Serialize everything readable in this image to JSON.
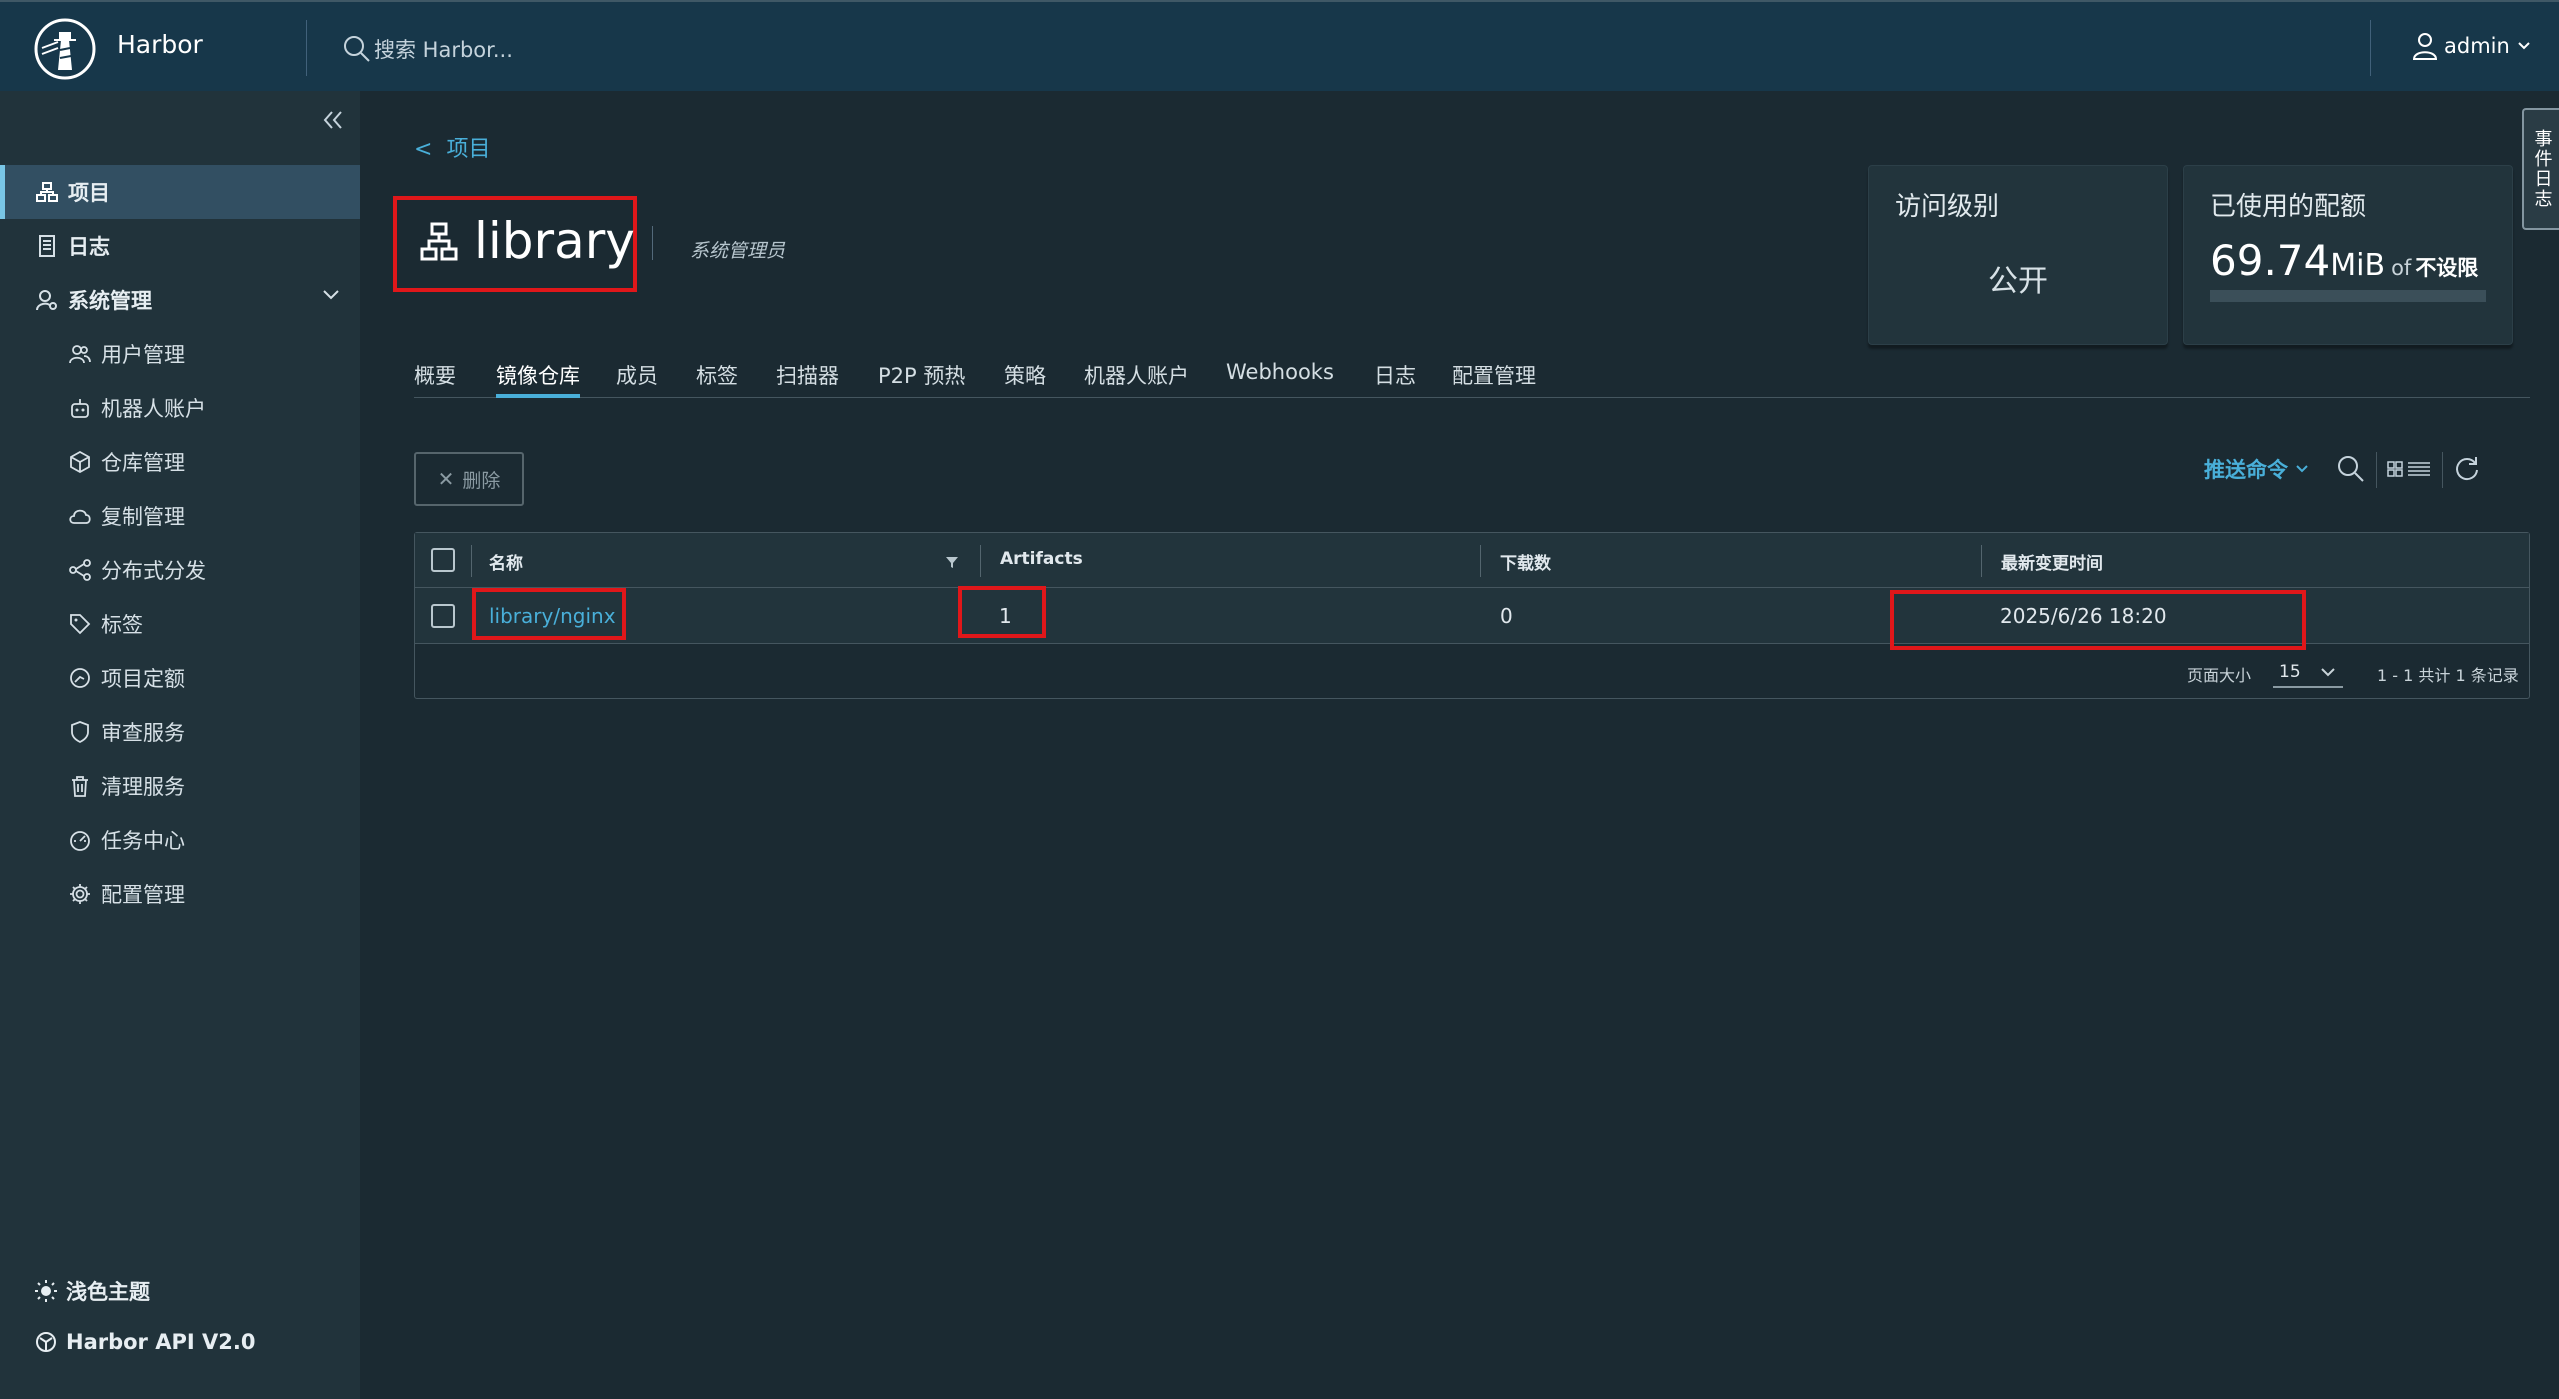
{
  "header": {
    "brand": "Harbor",
    "search_placeholder": "搜索 Harbor...",
    "user": "admin"
  },
  "sidebar": {
    "items": [
      {
        "label": "项目",
        "icon": "projects-icon"
      },
      {
        "label": "日志",
        "icon": "logs-icon"
      },
      {
        "label": "系统管理",
        "icon": "system-admin-icon"
      },
      {
        "label": "用户管理",
        "icon": "users-icon"
      },
      {
        "label": "机器人账户",
        "icon": "robot-icon"
      },
      {
        "label": "仓库管理",
        "icon": "registry-icon"
      },
      {
        "label": "复制管理",
        "icon": "replication-icon"
      },
      {
        "label": "分布式分发",
        "icon": "distribution-icon"
      },
      {
        "label": "标签",
        "icon": "tag-icon"
      },
      {
        "label": "项目定额",
        "icon": "quota-icon"
      },
      {
        "label": "审查服务",
        "icon": "shield-icon"
      },
      {
        "label": "清理服务",
        "icon": "trash-icon"
      },
      {
        "label": "任务中心",
        "icon": "dashboard-icon"
      },
      {
        "label": "配置管理",
        "icon": "gear-icon"
      }
    ],
    "theme": "浅色主题",
    "api": "Harbor API V2.0"
  },
  "project": {
    "back": "项目",
    "name": "library",
    "role": "系统管理员"
  },
  "cards": {
    "access_title": "访问级别",
    "access_value": "公开",
    "quota_title": "已使用的配额",
    "quota_num": "69.74",
    "quota_unit": "MiB",
    "quota_of": "of",
    "quota_limit": "不设限"
  },
  "side_tab": "事件日志",
  "tabs": [
    "概要",
    "镜像仓库",
    "成员",
    "标签",
    "扫描器",
    "P2P 预热",
    "策略",
    "机器人账户",
    "Webhooks",
    "日志",
    "配置管理"
  ],
  "active_tab": "镜像仓库",
  "toolbar": {
    "delete": "删除",
    "push_command": "推送命令"
  },
  "table": {
    "columns": [
      "名称",
      "Artifacts",
      "下载数",
      "最新变更时间"
    ],
    "rows": [
      {
        "name": "library/nginx",
        "artifacts": "1",
        "downloads": "0",
        "updated": "2025/6/26 18:20"
      }
    ],
    "page_size_label": "页面大小",
    "page_size": "15",
    "summary": "1 - 1 共计 1 条记录"
  },
  "colors": {
    "header_bg": "#17374a",
    "sidebar_bg": "#21333b",
    "main_bg": "#1b2a32",
    "accent": "#49afd9",
    "highlight": "#e0171a"
  }
}
